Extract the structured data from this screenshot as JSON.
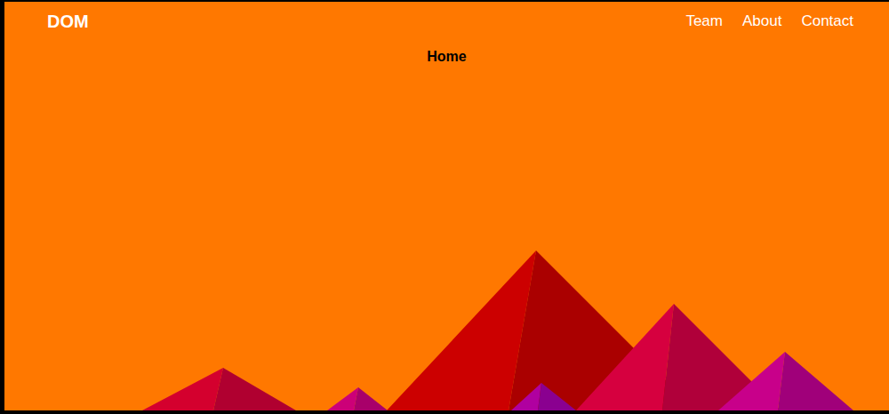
{
  "logo": "DOM",
  "nav": [
    {
      "label": "Team"
    },
    {
      "label": "About"
    },
    {
      "label": "Contact"
    }
  ],
  "heading": "Home"
}
